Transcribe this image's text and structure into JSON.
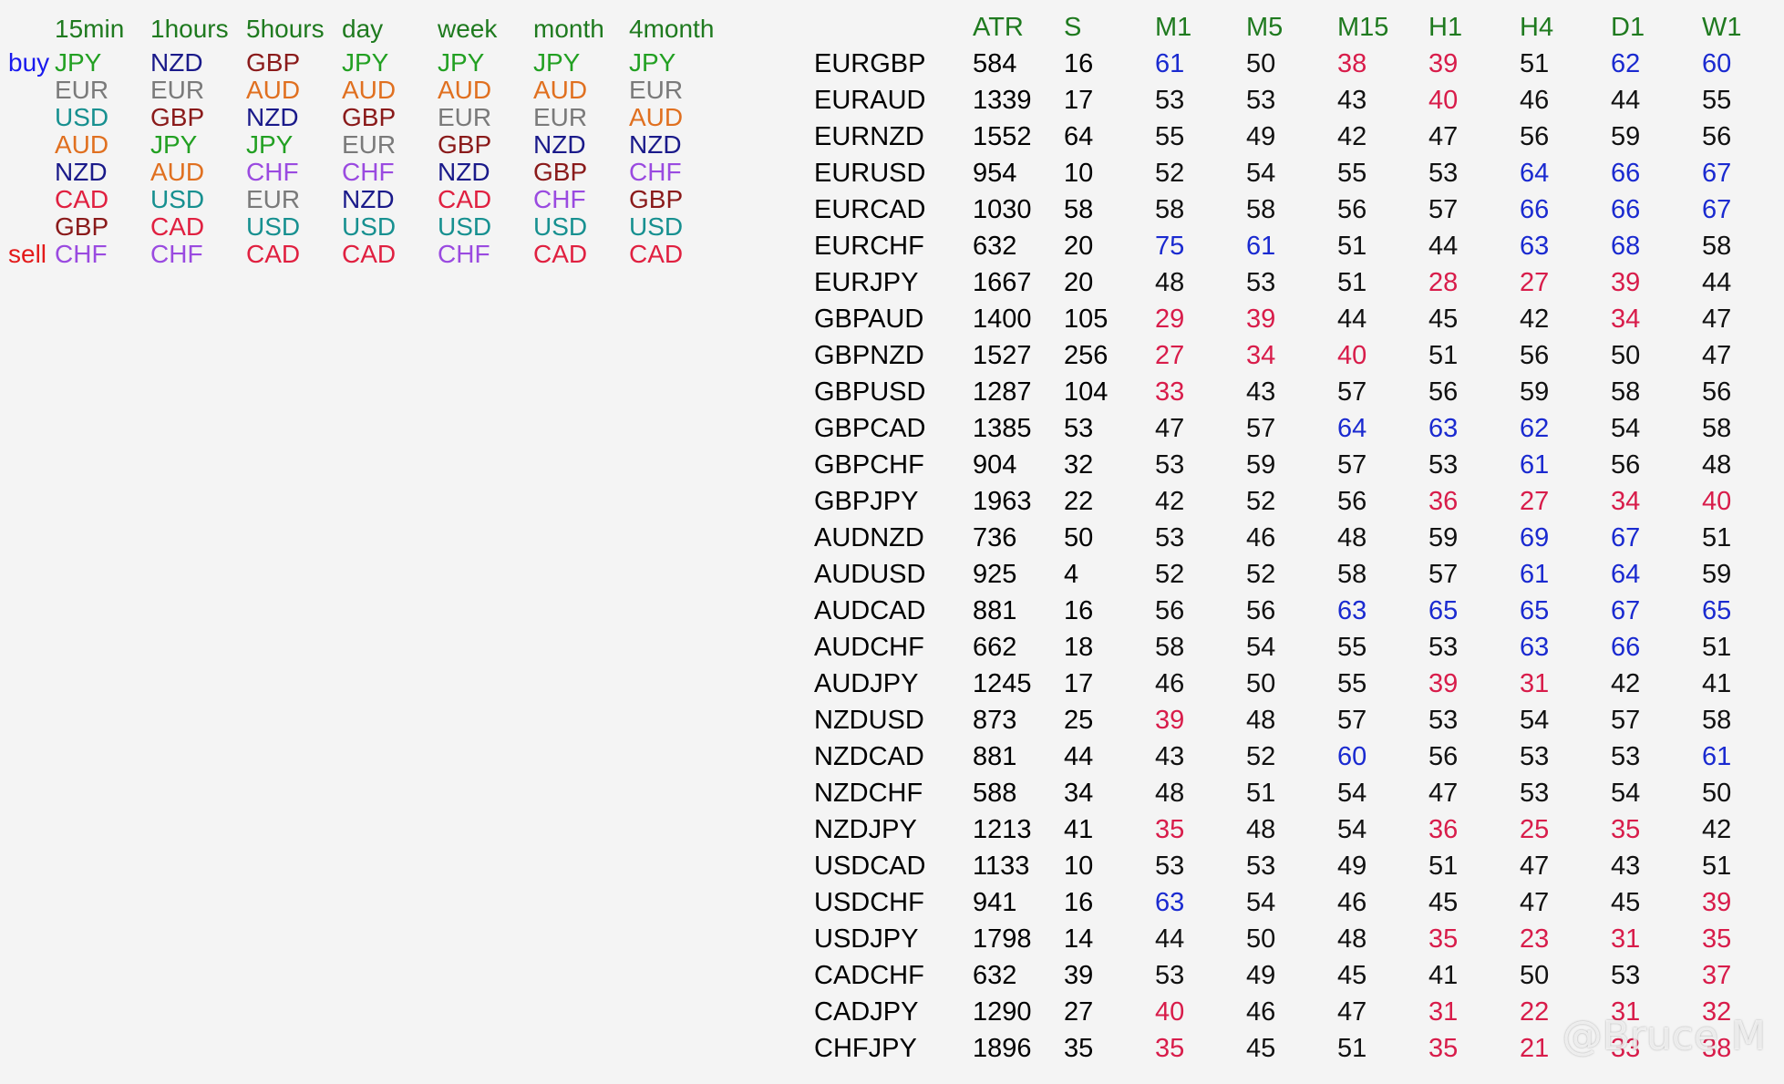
{
  "colors": {
    "header": "#1f7a1f",
    "buy": "#1a1aee",
    "sell": "#e31a1a",
    "currency": {
      "JPY": "#22a022",
      "EUR": "#7a7a7a",
      "USD": "#179090",
      "AUD": "#e07020",
      "NZD": "#1a1a8a",
      "CAD": "#e02040",
      "GBP": "#8a1a1a",
      "CHF": "#9a4ae0"
    },
    "value": {
      "high": "#1a2ad0",
      "low": "#d81c4a",
      "mid": "#111111"
    }
  },
  "strength": {
    "buy_label": "buy",
    "sell_label": "sell",
    "timeframes": [
      "15min",
      "1hours",
      "5hours",
      "day",
      "week",
      "month",
      "4month"
    ],
    "columns": [
      [
        "JPY",
        "EUR",
        "USD",
        "AUD",
        "NZD",
        "CAD",
        "GBP",
        "CHF"
      ],
      [
        "NZD",
        "EUR",
        "GBP",
        "JPY",
        "AUD",
        "USD",
        "CAD",
        "CHF"
      ],
      [
        "GBP",
        "AUD",
        "NZD",
        "JPY",
        "CHF",
        "EUR",
        "USD",
        "CAD"
      ],
      [
        "JPY",
        "AUD",
        "GBP",
        "EUR",
        "CHF",
        "NZD",
        "USD",
        "CAD"
      ],
      [
        "JPY",
        "AUD",
        "EUR",
        "GBP",
        "NZD",
        "CAD",
        "USD",
        "CHF"
      ],
      [
        "JPY",
        "AUD",
        "EUR",
        "NZD",
        "GBP",
        "CHF",
        "USD",
        "CAD"
      ],
      [
        "JPY",
        "EUR",
        "AUD",
        "NZD",
        "CHF",
        "GBP",
        "USD",
        "CAD"
      ]
    ]
  },
  "table": {
    "headers": [
      "ATR",
      "S",
      "M1",
      "M5",
      "M15",
      "H1",
      "H4",
      "D1",
      "W1"
    ],
    "rows": [
      [
        "EURGBP",
        "584",
        "16",
        "61",
        "50",
        "38",
        "39",
        "51",
        "62",
        "60"
      ],
      [
        "EURAUD",
        "1339",
        "17",
        "53",
        "53",
        "43",
        "40",
        "46",
        "44",
        "55"
      ],
      [
        "EURNZD",
        "1552",
        "64",
        "55",
        "49",
        "42",
        "47",
        "56",
        "59",
        "56"
      ],
      [
        "EURUSD",
        "954",
        "10",
        "52",
        "54",
        "55",
        "53",
        "64",
        "66",
        "67"
      ],
      [
        "EURCAD",
        "1030",
        "58",
        "58",
        "58",
        "56",
        "57",
        "66",
        "66",
        "67"
      ],
      [
        "EURCHF",
        "632",
        "20",
        "75",
        "61",
        "51",
        "44",
        "63",
        "68",
        "58"
      ],
      [
        "EURJPY",
        "1667",
        "20",
        "48",
        "53",
        "51",
        "28",
        "27",
        "39",
        "44"
      ],
      [
        "GBPAUD",
        "1400",
        "105",
        "29",
        "39",
        "44",
        "45",
        "42",
        "34",
        "47"
      ],
      [
        "GBPNZD",
        "1527",
        "256",
        "27",
        "34",
        "40",
        "51",
        "56",
        "50",
        "47"
      ],
      [
        "GBPUSD",
        "1287",
        "104",
        "33",
        "43",
        "57",
        "56",
        "59",
        "58",
        "56"
      ],
      [
        "GBPCAD",
        "1385",
        "53",
        "47",
        "57",
        "64",
        "63",
        "62",
        "54",
        "58"
      ],
      [
        "GBPCHF",
        "904",
        "32",
        "53",
        "59",
        "57",
        "53",
        "61",
        "56",
        "48"
      ],
      [
        "GBPJPY",
        "1963",
        "22",
        "42",
        "52",
        "56",
        "36",
        "27",
        "34",
        "40"
      ],
      [
        "AUDNZD",
        "736",
        "50",
        "53",
        "46",
        "48",
        "59",
        "69",
        "67",
        "51"
      ],
      [
        "AUDUSD",
        "925",
        "4",
        "52",
        "52",
        "58",
        "57",
        "61",
        "64",
        "59"
      ],
      [
        "AUDCAD",
        "881",
        "16",
        "56",
        "56",
        "63",
        "65",
        "65",
        "67",
        "65"
      ],
      [
        "AUDCHF",
        "662",
        "18",
        "58",
        "54",
        "55",
        "53",
        "63",
        "66",
        "51"
      ],
      [
        "AUDJPY",
        "1245",
        "17",
        "46",
        "50",
        "55",
        "39",
        "31",
        "42",
        "41"
      ],
      [
        "NZDUSD",
        "873",
        "25",
        "39",
        "48",
        "57",
        "53",
        "54",
        "57",
        "58"
      ],
      [
        "NZDCAD",
        "881",
        "44",
        "43",
        "52",
        "60",
        "56",
        "53",
        "53",
        "61"
      ],
      [
        "NZDCHF",
        "588",
        "34",
        "48",
        "51",
        "54",
        "47",
        "53",
        "54",
        "50"
      ],
      [
        "NZDJPY",
        "1213",
        "41",
        "35",
        "48",
        "54",
        "36",
        "25",
        "35",
        "42"
      ],
      [
        "USDCAD",
        "1133",
        "10",
        "53",
        "53",
        "49",
        "51",
        "47",
        "43",
        "51"
      ],
      [
        "USDCHF",
        "941",
        "16",
        "63",
        "54",
        "46",
        "45",
        "47",
        "45",
        "39"
      ],
      [
        "USDJPY",
        "1798",
        "14",
        "44",
        "50",
        "48",
        "35",
        "23",
        "31",
        "35"
      ],
      [
        "CADCHF",
        "632",
        "39",
        "53",
        "49",
        "45",
        "41",
        "50",
        "53",
        "37"
      ],
      [
        "CADJPY",
        "1290",
        "27",
        "40",
        "46",
        "47",
        "31",
        "22",
        "31",
        "32"
      ],
      [
        "CHFJPY",
        "1896",
        "35",
        "35",
        "45",
        "51",
        "35",
        "21",
        "33",
        "38"
      ]
    ]
  },
  "watermark": "@Bruce M"
}
